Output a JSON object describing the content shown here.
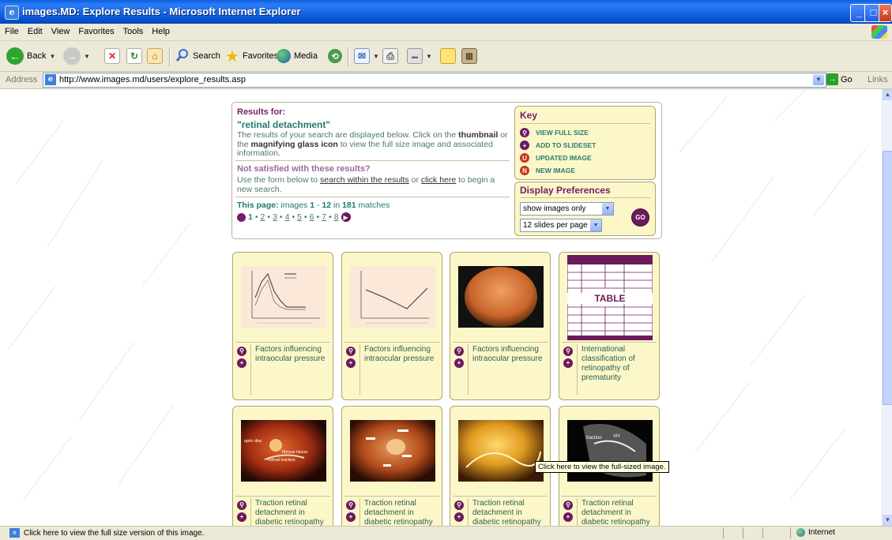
{
  "window": {
    "title": "images.MD: Explore Results - Microsoft Internet Explorer",
    "app_icon": "ie-page-icon",
    "controls": [
      "minimize",
      "maximize",
      "close"
    ]
  },
  "menubar": {
    "items": [
      "File",
      "Edit",
      "View",
      "Favorites",
      "Tools",
      "Help"
    ]
  },
  "toolbar": {
    "back_label": "Back",
    "search_label": "Search",
    "favorites_label": "Favorites",
    "media_label": "Media"
  },
  "address": {
    "label": "Address",
    "url": "http://www.images.md/users/explore_results.asp",
    "go_label": "Go",
    "links_label": "Links"
  },
  "results": {
    "title": "Results for:",
    "query": "\"retinal detachment\"",
    "desc_1": "The results of your search are displayed below. Click on the",
    "desc_thumbnail": "thumbnail",
    "desc_or": " or the ",
    "desc_glass": "magnifying glass icon",
    "desc_2": " to view the full size image and associated information.",
    "not_satisfied": "Not satisfied with these results?",
    "use_1": "Use the form below to ",
    "use_link1": "search within the results",
    "use_or": " or ",
    "use_link2": "click here",
    "use_2": " to begin a new search.",
    "this_page_label": "This page:",
    "this_page_mid": " images ",
    "range_start": "1",
    "range_dash": " - ",
    "range_end": "12",
    "in_word": " in ",
    "total": "181",
    "matches_word": " matches",
    "pages": [
      "1",
      "2",
      "3",
      "4",
      "5",
      "6",
      "7",
      "8"
    ],
    "current_page": "1"
  },
  "key": {
    "title": "Key",
    "items": [
      {
        "label": "VIEW FULL SIZE",
        "icon": "magnifier-icon"
      },
      {
        "label": "ADD TO SLIDESET",
        "icon": "plus-icon"
      },
      {
        "label": "UPDATED IMAGE",
        "icon": "updated-icon"
      },
      {
        "label": "NEW IMAGE",
        "icon": "new-icon"
      }
    ]
  },
  "display_prefs": {
    "title": "Display Preferences",
    "view_select": "show images only",
    "count_select": "12 slides per page",
    "go_label": "GO"
  },
  "cards": [
    {
      "caption": "Factors influencing intraocular pressure",
      "thumb": "chart-thumbnail-1"
    },
    {
      "caption": "Factors influencing intraocular pressure",
      "thumb": "chart-thumbnail-2"
    },
    {
      "caption": "Factors influencing intraocular pressure",
      "thumb": "fundus-photo-orange"
    },
    {
      "caption": "International classification of retinopathy of prematurity",
      "thumb": "table-thumbnail",
      "thumb_text": "TABLE"
    },
    {
      "caption": "Traction retinal detachment in diabetic retinopathy",
      "thumb": "fundus-photo-labeled-1",
      "thumb_labels": [
        "optic disc",
        "fibrous tissue",
        "retinal traction"
      ]
    },
    {
      "caption": "Traction retinal detachment in diabetic retinopathy",
      "thumb": "fundus-photo-labeled-2"
    },
    {
      "caption": "Traction retinal detachment in diabetic retinopathy",
      "thumb": "fundus-photo-yellow"
    },
    {
      "caption": "Traction retinal detachment in diabetic retinopathy",
      "thumb": "ultrasound-image",
      "thumb_labels": [
        "traction",
        "VH"
      ]
    }
  ],
  "tooltip": "Click here to view the full-sized image.",
  "statusbar": {
    "text": "Click here to view the full size version of this image.",
    "zone": "Internet"
  },
  "colors": {
    "accent_purple": "#7b1a68",
    "accent_teal": "#257a6a",
    "card_bg": "#fbf7c8",
    "xp_blue": "#0a5fe0"
  }
}
